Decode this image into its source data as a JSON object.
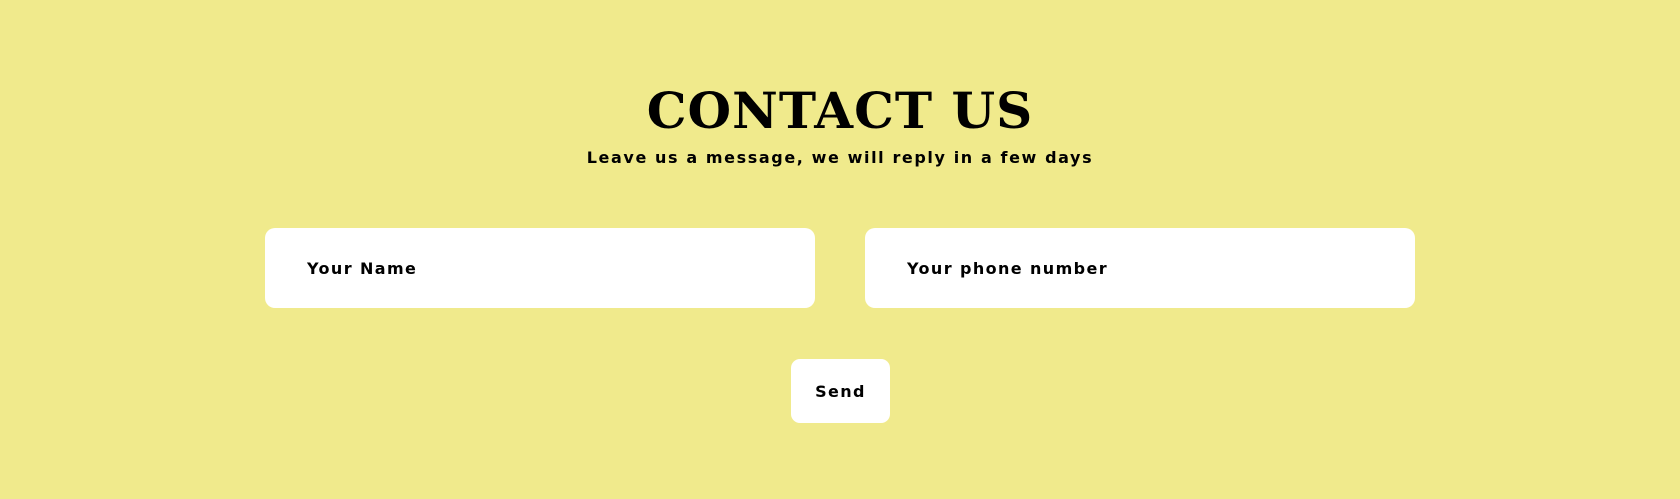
{
  "contact": {
    "title": "Contact us",
    "subtitle": "Leave us a message, we will reply in a few days",
    "name_placeholder": "Your Name",
    "phone_placeholder": "Your phone number",
    "send_label": "Send"
  },
  "colors": {
    "background": "#f0ea8c",
    "field_background": "#ffffff",
    "text": "#000000"
  }
}
